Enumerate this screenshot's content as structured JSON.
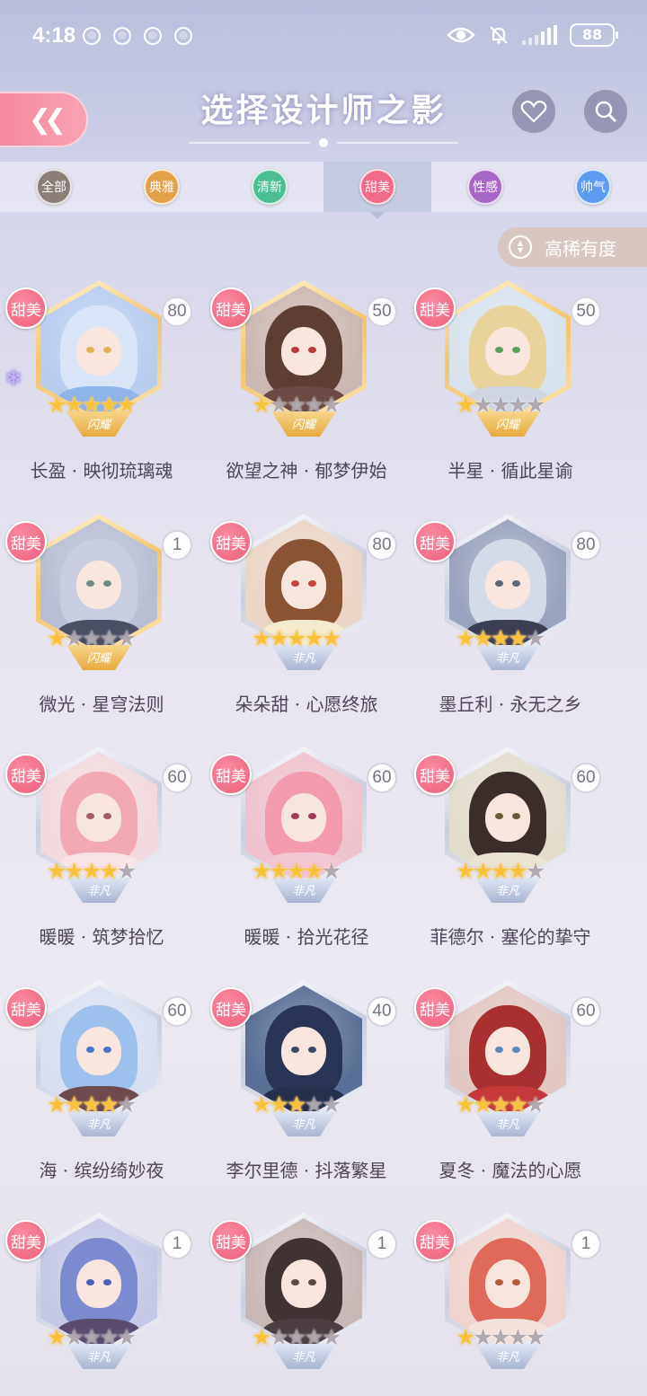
{
  "status_bar": {
    "time": "4:18",
    "battery": "88",
    "notification_count": 4
  },
  "header": {
    "title": "选择设计师之影",
    "back_icon": "double-chevron-left-icon"
  },
  "tabs": [
    {
      "label": "全部",
      "color": "#8b7d78",
      "active": false
    },
    {
      "label": "典雅",
      "color": "#e3a14a",
      "active": false
    },
    {
      "label": "清新",
      "color": "#4cbf92",
      "active": false
    },
    {
      "label": "甜美",
      "color": "#f26b88",
      "active": true
    },
    {
      "label": "性感",
      "color": "#a667c8",
      "active": false
    },
    {
      "label": "帅气",
      "color": "#5d9cf0",
      "active": false
    }
  ],
  "sort": {
    "label": "高稀有度"
  },
  "cards": [
    {
      "badge": "甜美",
      "level": "80",
      "stars": 5,
      "name": "长盈 · 映彻琉璃魂",
      "grade": "gold",
      "grade_text": "闪耀",
      "emblem": true,
      "palette": {
        "bg": "#b9cdef",
        "hair": "#d9e4f6",
        "body": "#8fb4ea",
        "eye": "#e3b35a"
      }
    },
    {
      "badge": "甜美",
      "level": "50",
      "stars": 1,
      "name": "欲望之神 · 郁梦伊始",
      "grade": "gold",
      "grade_text": "闪耀",
      "emblem": false,
      "palette": {
        "bg": "#cbb7b1",
        "hair": "#5c3e34",
        "body": "#6a4a44",
        "eye": "#b73a3c"
      }
    },
    {
      "badge": "甜美",
      "level": "50",
      "stars": 1,
      "name": "半星 · 循此星谕",
      "grade": "gold",
      "grade_text": "闪耀",
      "emblem": false,
      "palette": {
        "bg": "#d7e2ed",
        "hair": "#e8d39b",
        "body": "#cfd6e2",
        "eye": "#5aa05c"
      }
    },
    {
      "badge": "甜美",
      "level": "1",
      "stars": 1,
      "name": "微光 · 星穹法则",
      "grade": "gold",
      "grade_text": "闪耀",
      "emblem": false,
      "palette": {
        "bg": "#b9bfd3",
        "hair": "#c9cfe1",
        "body": "#4a4f63",
        "eye": "#6d8c86"
      }
    },
    {
      "badge": "甜美",
      "level": "80",
      "stars": 5,
      "name": "朵朵甜 · 心愿终旅",
      "grade": "silver",
      "grade_text": "非凡",
      "emblem": false,
      "palette": {
        "bg": "#ead5c6",
        "hair": "#8a5434",
        "body": "#f3ead0",
        "eye": "#c3443a"
      }
    },
    {
      "badge": "甜美",
      "level": "80",
      "stars": 4,
      "name": "墨丘利 · 永无之乡",
      "grade": "silver",
      "grade_text": "非凡",
      "emblem": false,
      "palette": {
        "bg": "#9aa3bd",
        "hair": "#d4dbe8",
        "body": "#3c3f54",
        "eye": "#5b6777"
      }
    },
    {
      "badge": "甜美",
      "level": "60",
      "stars": 4,
      "name": "暖暖 · 筑梦拾忆",
      "grade": "silver",
      "grade_text": "非凡",
      "emblem": false,
      "palette": {
        "bg": "#f1d9dd",
        "hair": "#f2a9b3",
        "body": "#f7e3e6",
        "eye": "#a35b66"
      }
    },
    {
      "badge": "甜美",
      "level": "60",
      "stars": 4,
      "name": "暖暖 · 拾光花径",
      "grade": "silver",
      "grade_text": "非凡",
      "emblem": false,
      "palette": {
        "bg": "#eec3cd",
        "hair": "#f39aae",
        "body": "#f4c6d3",
        "eye": "#9d3b56"
      }
    },
    {
      "badge": "甜美",
      "level": "60",
      "stars": 4,
      "name": "菲德尔 · 塞伦的挚守",
      "grade": "silver",
      "grade_text": "非凡",
      "emblem": false,
      "palette": {
        "bg": "#e2dccd",
        "hair": "#3b2e2a",
        "body": "#e9e3d3",
        "eye": "#6b5a3a"
      }
    },
    {
      "badge": "甜美",
      "level": "60",
      "stars": 4,
      "name": "海 · 缤纷绮妙夜",
      "grade": "silver",
      "grade_text": "非凡",
      "emblem": false,
      "palette": {
        "bg": "#d8dff0",
        "hair": "#9ec0ec",
        "body": "#6c4a4e",
        "eye": "#4a74c4"
      }
    },
    {
      "badge": "甜美",
      "level": "40",
      "stars": 3,
      "name": "李尔里德 · 抖落繁星",
      "grade": "silver",
      "grade_text": "非凡",
      "emblem": false,
      "palette": {
        "bg": "#5a6f95",
        "hair": "#2a3454",
        "body": "#27304a",
        "eye": "#3d4a66"
      }
    },
    {
      "badge": "甜美",
      "level": "60",
      "stars": 4,
      "name": "夏冬 · 魔法的心愿",
      "grade": "silver",
      "grade_text": "非凡",
      "emblem": false,
      "palette": {
        "bg": "#e2c7c3",
        "hair": "#a83030",
        "body": "#c43a3a",
        "eye": "#5b87b9"
      }
    },
    {
      "badge": "甜美",
      "level": "1",
      "stars": 1,
      "name": "",
      "grade": "silver",
      "grade_text": "非凡",
      "emblem": false,
      "palette": {
        "bg": "#c6c9e6",
        "hair": "#7c8ad0",
        "body": "#5a4c6e",
        "eye": "#4a60b8"
      }
    },
    {
      "badge": "甜美",
      "level": "1",
      "stars": 1,
      "name": "",
      "grade": "silver",
      "grade_text": "非凡",
      "emblem": false,
      "palette": {
        "bg": "#c7b8b6",
        "hair": "#3f3433",
        "body": "#4b3f44",
        "eye": "#5a4a44"
      }
    },
    {
      "badge": "甜美",
      "level": "1",
      "stars": 1,
      "name": "",
      "grade": "silver",
      "grade_text": "非凡",
      "emblem": false,
      "palette": {
        "bg": "#efd3cf",
        "hair": "#e06a5a",
        "body": "#f3e2dc",
        "eye": "#b05c3a"
      }
    }
  ]
}
